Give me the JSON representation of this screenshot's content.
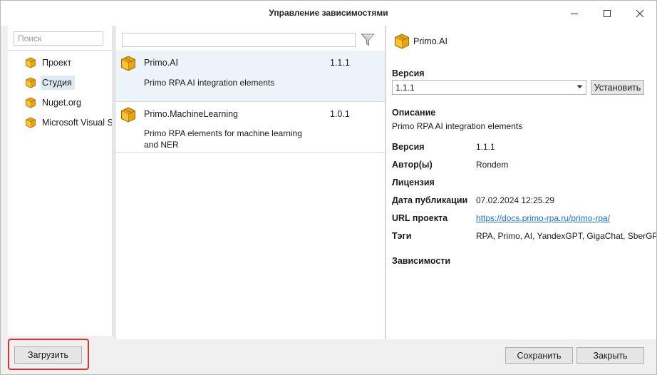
{
  "window": {
    "title": "Управление зависимостями"
  },
  "sources": {
    "search_placeholder": "Поиск",
    "items": [
      {
        "label": "Проект",
        "icon": "package-icon"
      },
      {
        "label": "Студия",
        "icon": "package-icon",
        "selected": true
      },
      {
        "label": "Nuget.org",
        "icon": "package-icon"
      },
      {
        "label": "Microsoft Visual S",
        "icon": "package-icon"
      }
    ]
  },
  "packages": {
    "search_value": "",
    "filter_icon": "filter-icon",
    "items": [
      {
        "name": "Primo.AI",
        "version": "1.1.1",
        "description": "Primo RPA AI integration elements",
        "selected": true
      },
      {
        "name": "Primo.MachineLearning",
        "version": "1.0.1",
        "description": "Primo RPA elements for machine learning and NER"
      }
    ]
  },
  "details": {
    "name": "Primo.AI",
    "version_label": "Версия",
    "version_selected": "1.1.1",
    "install_label": "Установить",
    "description_label": "Описание",
    "description": "Primo RPA AI integration elements",
    "fields": [
      {
        "label": "Версия",
        "value": "1.1.1"
      },
      {
        "label": "Автор(ы)",
        "value": "Rondem"
      },
      {
        "label": "Лицензия",
        "value": ""
      },
      {
        "label": "Дата публикации",
        "value": "07.02.2024 12:25.29"
      },
      {
        "label": "URL проекта",
        "value": "https://docs.primo-rpa.ru/primo-rpa/"
      },
      {
        "label": "Тэги",
        "value": "RPA, Primo, AI, YandexGPT, GigaChat, SberGPT"
      }
    ],
    "dependencies_label": "Зависимости"
  },
  "footer": {
    "upload_label": "Загрузить",
    "save_label": "Сохранить",
    "close_label": "Закрыть"
  },
  "colors": {
    "highlight_frame": "#d9342b",
    "selected_row": "#ecf4fa",
    "link": "#1f6fc5"
  }
}
